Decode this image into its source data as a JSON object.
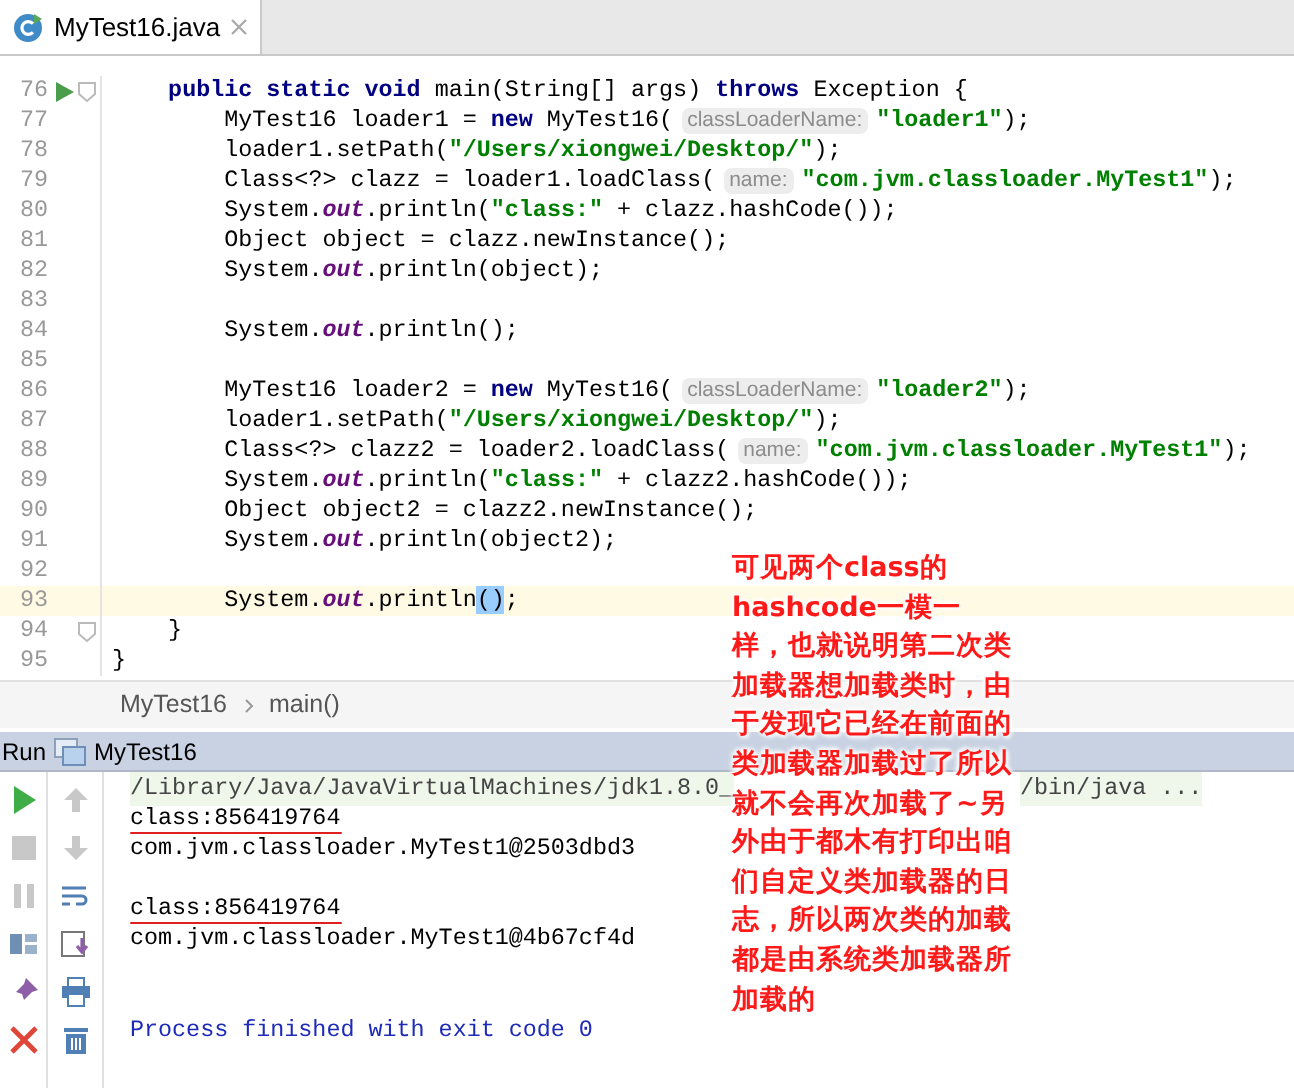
{
  "tab": {
    "title": "MyTest16.java",
    "selected": true
  },
  "editor": {
    "lines": [
      {
        "number": "76",
        "run": true,
        "fold": true,
        "current": false,
        "tokens": [
          {
            "kind": "keyword",
            "text": "    public static void"
          },
          {
            "kind": "plain",
            "text": " main(String[] args) "
          },
          {
            "kind": "keyword",
            "text": "throws"
          },
          {
            "kind": "plain",
            "text": " Exception {"
          }
        ]
      },
      {
        "number": "77",
        "run": false,
        "fold": false,
        "current": false,
        "tokens": [
          {
            "kind": "plain",
            "text": "        MyTest16 loader1 = "
          },
          {
            "kind": "keyword",
            "text": "new"
          },
          {
            "kind": "plain",
            "text": " MyTest16("
          },
          {
            "kind": "hint",
            "text": "classLoaderName:"
          },
          {
            "kind": "string",
            "text": "\"loader1\""
          },
          {
            "kind": "plain",
            "text": ");"
          }
        ]
      },
      {
        "number": "78",
        "run": false,
        "fold": false,
        "current": false,
        "tokens": [
          {
            "kind": "plain",
            "text": "        loader1.setPath("
          },
          {
            "kind": "string",
            "text": "\"/Users/xiongwei/Desktop/\""
          },
          {
            "kind": "plain",
            "text": ");"
          }
        ]
      },
      {
        "number": "79",
        "run": false,
        "fold": false,
        "current": false,
        "tokens": [
          {
            "kind": "plain",
            "text": "        Class<?> clazz = loader1.loadClass("
          },
          {
            "kind": "hint",
            "text": "name:"
          },
          {
            "kind": "string",
            "text": "\"com.jvm.classloader.MyTest1\""
          },
          {
            "kind": "plain",
            "text": ");"
          }
        ]
      },
      {
        "number": "80",
        "run": false,
        "fold": false,
        "current": false,
        "tokens": [
          {
            "kind": "plain",
            "text": "        System."
          },
          {
            "kind": "field",
            "text": "out"
          },
          {
            "kind": "plain",
            "text": ".println("
          },
          {
            "kind": "string",
            "text": "\"class:\""
          },
          {
            "kind": "plain",
            "text": " + clazz.hashCode());"
          }
        ]
      },
      {
        "number": "81",
        "run": false,
        "fold": false,
        "current": false,
        "tokens": [
          {
            "kind": "plain",
            "text": "        Object object = clazz.newInstance();"
          }
        ]
      },
      {
        "number": "82",
        "run": false,
        "fold": false,
        "current": false,
        "tokens": [
          {
            "kind": "plain",
            "text": "        System."
          },
          {
            "kind": "field",
            "text": "out"
          },
          {
            "kind": "plain",
            "text": ".println(object);"
          }
        ]
      },
      {
        "number": "83",
        "run": false,
        "fold": false,
        "current": false
      },
      {
        "number": "84",
        "run": false,
        "fold": false,
        "current": false,
        "tokens": [
          {
            "kind": "plain",
            "text": "        System."
          },
          {
            "kind": "field",
            "text": "out"
          },
          {
            "kind": "plain",
            "text": ".println();"
          }
        ]
      },
      {
        "number": "85",
        "run": false,
        "fold": false,
        "current": false
      },
      {
        "number": "86",
        "run": false,
        "fold": false,
        "current": false,
        "tokens": [
          {
            "kind": "plain",
            "text": "        MyTest16 loader2 = "
          },
          {
            "kind": "keyword",
            "text": "new"
          },
          {
            "kind": "plain",
            "text": " MyTest16("
          },
          {
            "kind": "hint",
            "text": "classLoaderName:"
          },
          {
            "kind": "string",
            "text": "\"loader2\""
          },
          {
            "kind": "plain",
            "text": ");"
          }
        ]
      },
      {
        "number": "87",
        "run": false,
        "fold": false,
        "current": false,
        "tokens": [
          {
            "kind": "plain",
            "text": "        loader1.setPath("
          },
          {
            "kind": "string",
            "text": "\"/Users/xiongwei/Desktop/\""
          },
          {
            "kind": "plain",
            "text": ");"
          }
        ]
      },
      {
        "number": "88",
        "run": false,
        "fold": false,
        "current": false,
        "tokens": [
          {
            "kind": "plain",
            "text": "        Class<?> clazz2 = loader2.loadClass("
          },
          {
            "kind": "hint",
            "text": "name:"
          },
          {
            "kind": "string",
            "text": "\"com.jvm.classloader.MyTest1\""
          },
          {
            "kind": "plain",
            "text": ");"
          }
        ]
      },
      {
        "number": "89",
        "run": false,
        "fold": false,
        "current": false,
        "tokens": [
          {
            "kind": "plain",
            "text": "        System."
          },
          {
            "kind": "field",
            "text": "out"
          },
          {
            "kind": "plain",
            "text": ".println("
          },
          {
            "kind": "string",
            "text": "\"class:\""
          },
          {
            "kind": "plain",
            "text": " + clazz2.hashCode());"
          }
        ]
      },
      {
        "number": "90",
        "run": false,
        "fold": false,
        "current": false,
        "tokens": [
          {
            "kind": "plain",
            "text": "        Object object2 = clazz2.newInstance();"
          }
        ]
      },
      {
        "number": "91",
        "run": false,
        "fold": false,
        "current": false,
        "tokens": [
          {
            "kind": "plain",
            "text": "        System."
          },
          {
            "kind": "field",
            "text": "out"
          },
          {
            "kind": "plain",
            "text": ".println(object2);"
          }
        ]
      },
      {
        "number": "92",
        "run": false,
        "fold": false,
        "current": false
      },
      {
        "number": "93",
        "run": false,
        "fold": false,
        "current": true,
        "tokens": [
          {
            "kind": "plain",
            "text": "        System."
          },
          {
            "kind": "field",
            "text": "out"
          },
          {
            "kind": "plain",
            "text": ".println"
          },
          {
            "kind": "match",
            "text": "()"
          },
          {
            "kind": "plain",
            "text": ";"
          }
        ]
      },
      {
        "number": "94",
        "run": false,
        "fold": true,
        "current": false,
        "tokens": [
          {
            "kind": "plain",
            "text": "    }"
          }
        ]
      },
      {
        "number": "95",
        "run": false,
        "fold": false,
        "current": false,
        "tokens": [
          {
            "kind": "plain",
            "text": "}"
          }
        ]
      }
    ]
  },
  "breadcrumb": [
    "MyTest16",
    "main()"
  ],
  "run_panel": {
    "label": "Run",
    "title": "MyTest16",
    "console": [
      {
        "kind": "command",
        "text": "/Library/Java/JavaVirtualMachines/jdk1.8.0_",
        "text_after": "/bin/java ..."
      },
      {
        "kind": "output",
        "text": "class:856419764",
        "underlined": true
      },
      {
        "kind": "output",
        "text": "com.jvm.classloader.MyTest1@2503dbd3",
        "underlined": false
      },
      {
        "kind": "blank"
      },
      {
        "kind": "output",
        "text": "class:856419764",
        "underlined": true
      },
      {
        "kind": "output",
        "text": "com.jvm.classloader.MyTest1@4b67cf4d",
        "underlined": false
      },
      {
        "kind": "blank"
      },
      {
        "kind": "blank"
      },
      {
        "kind": "exit",
        "text": "Process finished with exit code 0"
      }
    ]
  },
  "annotation": "可见两个class的hashcode一模一样，也就说明第二次类加载器想加载类时，由于发现它已经在前面的类加载器加载过了所以就不会再次加载了~另外由于都木有打印出咱们自定义类加载器的日志，所以两次类的加载都是由系统类加载器所加载的"
}
